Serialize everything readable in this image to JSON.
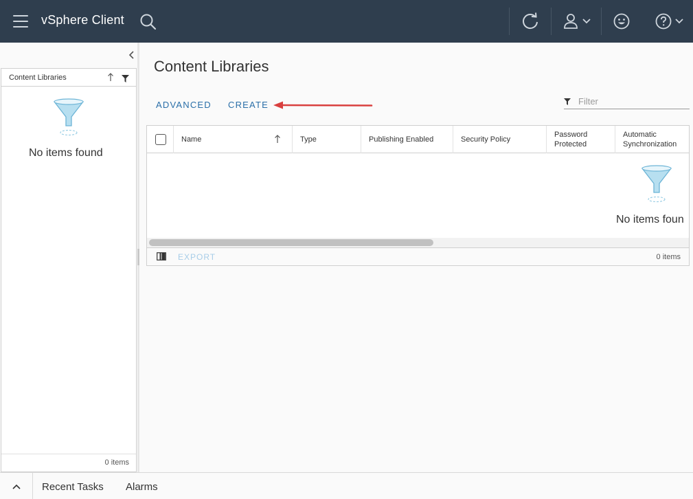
{
  "header": {
    "app_title": "vSphere Client",
    "icons": [
      "menu-icon",
      "search-icon",
      "refresh-icon",
      "user-icon",
      "smiley-icon",
      "help-icon"
    ],
    "background": "#2f3e4e"
  },
  "left_panel": {
    "column_title": "Content Libraries",
    "empty_message": "No items found",
    "footer_count": "0 items"
  },
  "main": {
    "title": "Content Libraries",
    "actions": {
      "advanced": "ADVANCED",
      "create": "CREATE"
    },
    "filter": {
      "placeholder": "Filter"
    },
    "grid": {
      "columns": [
        {
          "label": "Name"
        },
        {
          "label": "Type"
        },
        {
          "label": "Publishing Enabled"
        },
        {
          "label": "Security Policy"
        },
        {
          "label": "Password\nProtected"
        },
        {
          "label": "Automatic\nSynchronization"
        }
      ],
      "empty_message": "No items foun",
      "footer": {
        "export_label": "EXPORT",
        "count": "0 items"
      }
    },
    "link_color": "#2a6fa8",
    "annotation_color": "#d9403f"
  },
  "bottom_bar": {
    "tabs": [
      "Recent Tasks",
      "Alarms"
    ]
  }
}
